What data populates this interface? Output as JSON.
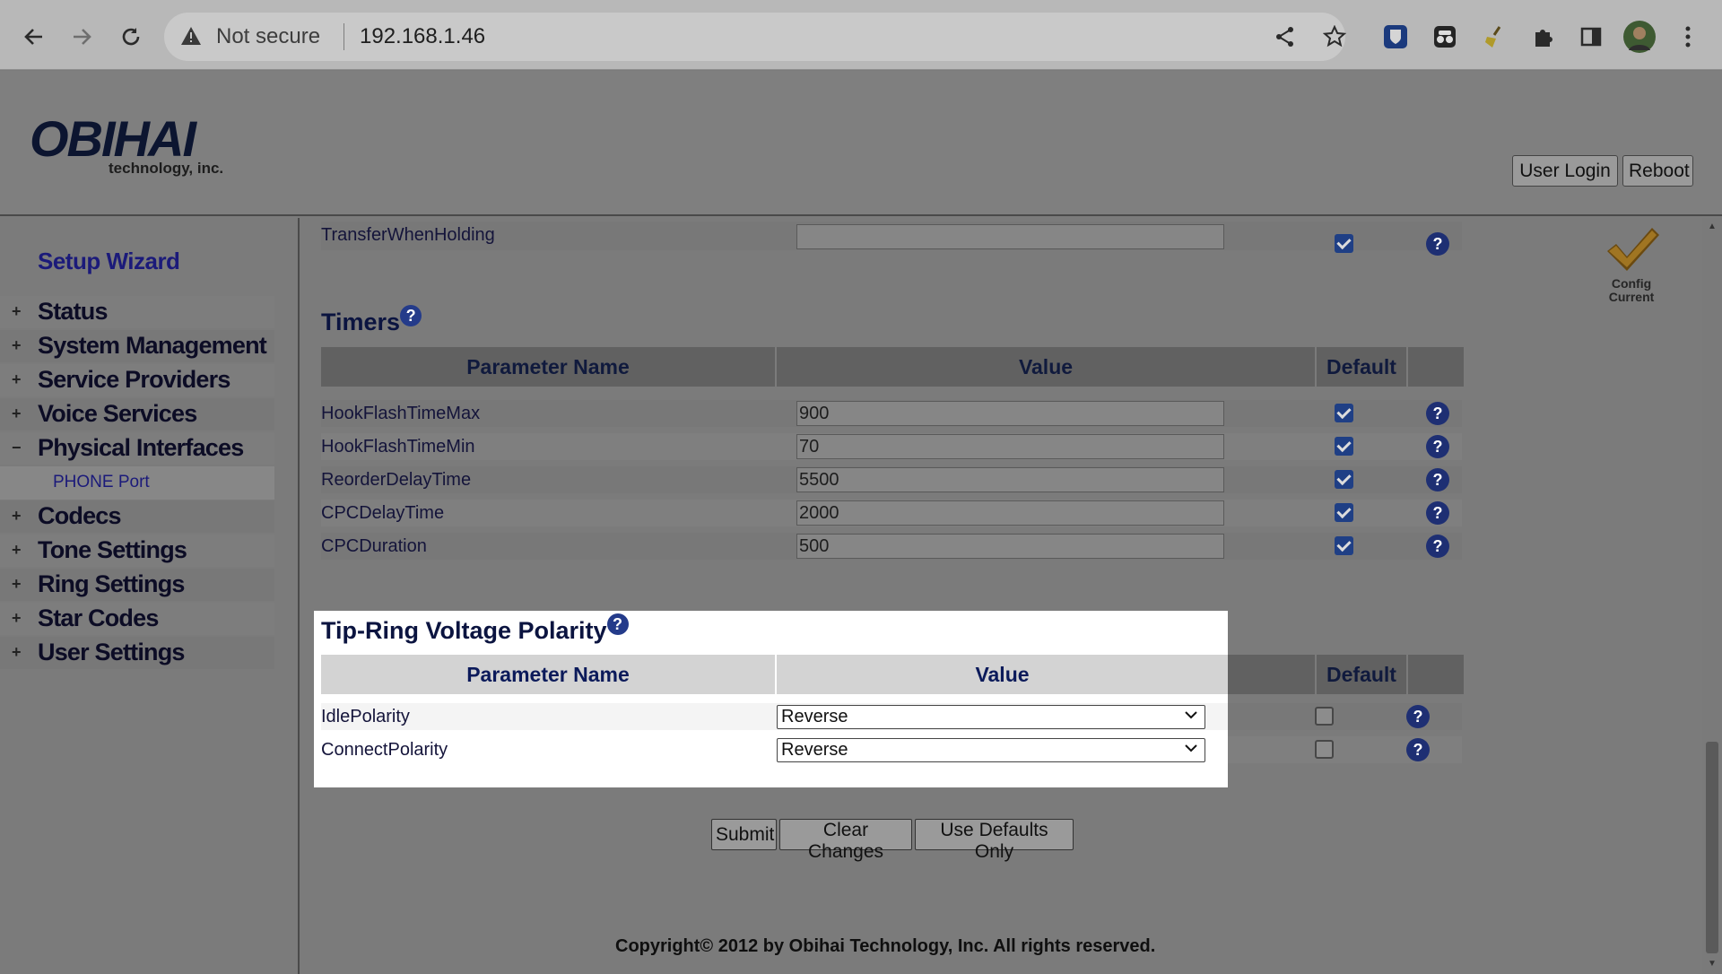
{
  "browser": {
    "security_label": "Not secure",
    "url": "192.168.1.46"
  },
  "header": {
    "logo_main": "OBIHAI",
    "logo_sub": "technology, inc.",
    "user_login": "User Login",
    "reboot": "Reboot"
  },
  "sidebar": {
    "setup_wizard": "Setup Wizard",
    "items": [
      {
        "toggle": "+",
        "label": "Status"
      },
      {
        "toggle": "+",
        "label": "System Management"
      },
      {
        "toggle": "+",
        "label": "Service Providers"
      },
      {
        "toggle": "+",
        "label": "Voice Services"
      },
      {
        "toggle": "−",
        "label": "Physical Interfaces"
      },
      {
        "toggle": "+",
        "label": "Codecs"
      },
      {
        "toggle": "+",
        "label": "Tone Settings"
      },
      {
        "toggle": "+",
        "label": "Ring Settings"
      },
      {
        "toggle": "+",
        "label": "Star Codes"
      },
      {
        "toggle": "+",
        "label": "User Settings"
      }
    ],
    "sub_item": "PHONE Port"
  },
  "status": {
    "config_line1": "Config",
    "config_line2": "Current"
  },
  "top_row": {
    "name": "TransferWhenHolding",
    "value": "",
    "default": true
  },
  "timers": {
    "title": "Timers",
    "col_name": "Parameter Name",
    "col_value": "Value",
    "col_default": "Default",
    "rows": [
      {
        "name": "HookFlashTimeMax",
        "value": "900",
        "default": true
      },
      {
        "name": "HookFlashTimeMin",
        "value": "70",
        "default": true
      },
      {
        "name": "ReorderDelayTime",
        "value": "5500",
        "default": true
      },
      {
        "name": "CPCDelayTime",
        "value": "2000",
        "default": true
      },
      {
        "name": "CPCDuration",
        "value": "500",
        "default": true
      }
    ]
  },
  "polarity": {
    "title": "Tip-Ring Voltage Polarity",
    "col_name": "Parameter Name",
    "col_value": "Value",
    "col_default": "Default",
    "rows": [
      {
        "name": "IdlePolarity",
        "value": "Reverse",
        "default": false
      },
      {
        "name": "ConnectPolarity",
        "value": "Reverse",
        "default": false
      }
    ]
  },
  "buttons": {
    "submit": "Submit",
    "clear": "Clear Changes",
    "defaults": "Use Defaults Only"
  },
  "footer": {
    "copyright": "Copyright© 2012 by Obihai Technology, Inc. All rights reserved."
  },
  "help_glyph": "?",
  "colors": {
    "link": "#1b1a7a",
    "checkbox": "#1f3f85",
    "highlight_header": "#d3d3d3"
  }
}
